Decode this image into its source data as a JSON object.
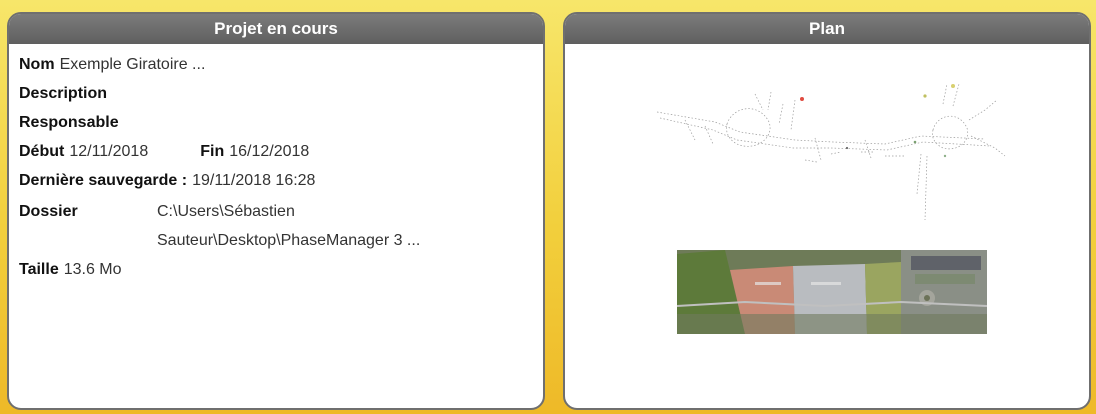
{
  "project_panel": {
    "title": "Projet en cours",
    "nom_label": "Nom",
    "nom_value": "Exemple Giratoire ...",
    "description_label": "Description",
    "responsable_label": "Responsable",
    "debut_label": "Début",
    "debut_value": "12/11/2018",
    "fin_label": "Fin",
    "fin_value": "16/12/2018",
    "save_label": "Dernière sauvegarde :",
    "save_value": "19/11/2018 16:28",
    "dossier_label": "Dossier",
    "dossier_line1": "C:\\Users\\Sébastien",
    "dossier_line2": "Sauteur\\Desktop\\PhaseManager 3 ...",
    "taille_label": "Taille",
    "taille_value": "13.6 Mo"
  },
  "plan_panel": {
    "title": "Plan"
  },
  "colors": {
    "background_top": "#f7e66a",
    "background_bottom": "#eeb928",
    "header_gray": "#6a6a6a",
    "panel_border": "#6f6f6f"
  }
}
